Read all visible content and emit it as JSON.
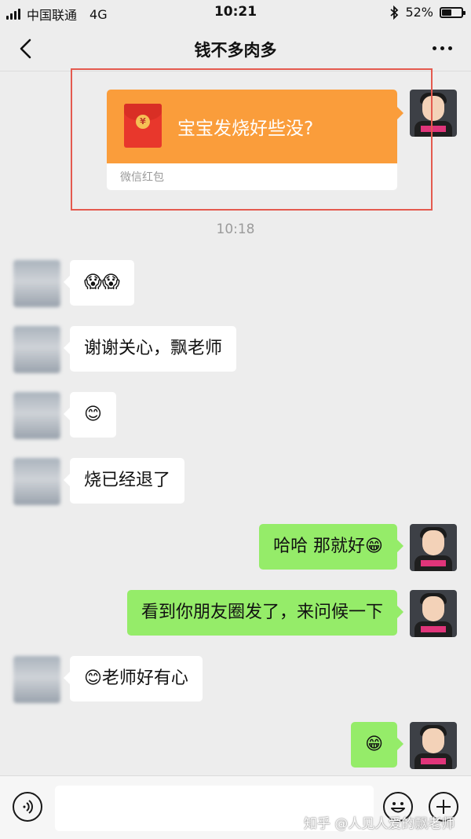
{
  "status_bar": {
    "carrier": "中国联通",
    "network": "4G",
    "time": "10:21",
    "battery": "52%",
    "battery_level": 0.52
  },
  "header": {
    "title": "钱不多肉多"
  },
  "red_packet": {
    "message": "宝宝发烧好些没?",
    "label": "微信红包",
    "icon_glyph": "¥"
  },
  "time_divider": "10:18",
  "messages": [
    {
      "side": "other",
      "text": "😱😱"
    },
    {
      "side": "other",
      "text": "谢谢关心，飘老师"
    },
    {
      "side": "other",
      "text": "😊"
    },
    {
      "side": "other",
      "text": "烧已经退了"
    },
    {
      "side": "self",
      "text": "哈哈 那就好😁"
    },
    {
      "side": "self",
      "text": "看到你朋友圈发了，来问候一下"
    },
    {
      "side": "other",
      "text": "😊老师好有心"
    },
    {
      "side": "self",
      "text": "😁"
    }
  ],
  "watermark": "知乎 @人见人爱的飘老师",
  "colors": {
    "background": "#ededed",
    "self_bubble": "#95ec69",
    "other_bubble": "#ffffff",
    "red_packet": "#fa9d3b",
    "highlight": "#e45a4f"
  },
  "icons": [
    "back-icon",
    "more-icon",
    "voice-icon",
    "emoji-icon",
    "plus-icon",
    "bluetooth-icon",
    "battery-icon",
    "signal-icon"
  ]
}
